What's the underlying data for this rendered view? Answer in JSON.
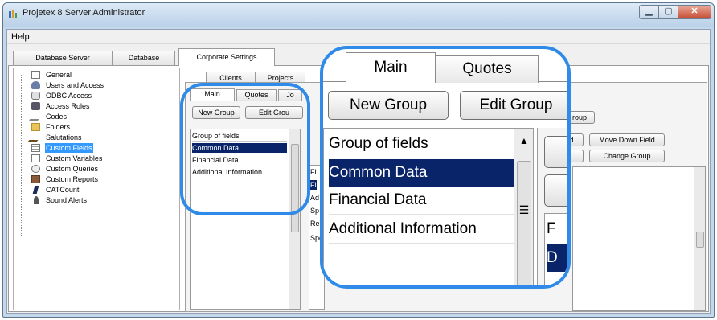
{
  "window": {
    "title": "Projetex 8 Server Administrator",
    "minimize_glyph": "▁",
    "maximize_glyph": "▢",
    "close_glyph": "✕"
  },
  "menu": {
    "help": "Help"
  },
  "top_tabs": [
    "Database Server",
    "Database",
    "Corporate Settings"
  ],
  "tree": {
    "items": [
      {
        "label": "General",
        "icon": "document-icon"
      },
      {
        "label": "Users and Access",
        "icon": "user-icon"
      },
      {
        "label": "ODBC Access",
        "icon": "database-icon"
      },
      {
        "label": "Access Roles",
        "icon": "roles-icon"
      },
      {
        "label": "Codes",
        "icon": "pencil-icon"
      },
      {
        "label": "Folders",
        "icon": "folder-icon"
      },
      {
        "label": "Salutations",
        "icon": "pen-icon"
      },
      {
        "label": "Custom Fields",
        "icon": "fields-icon",
        "selected": true
      },
      {
        "label": "Custom Variables",
        "icon": "document-icon"
      },
      {
        "label": "Custom Queries",
        "icon": "queries-icon"
      },
      {
        "label": "Custom Reports",
        "icon": "reports-icon"
      },
      {
        "label": "CATCount",
        "icon": "catcount-icon"
      },
      {
        "label": "Sound Alerts",
        "icon": "sound-icon"
      }
    ]
  },
  "second_tabs": [
    "Clients",
    "Projects"
  ],
  "third_tabs": [
    "Main",
    "Quotes",
    "Jo"
  ],
  "buttons": {
    "new_group": "New Group",
    "edit_group": "Edit Grou",
    "edit_group_bg": "roup"
  },
  "groups_list": {
    "header": "Group of fields",
    "items": [
      "Common Data",
      "Financial Data",
      "Additional Information"
    ],
    "selected": "Common Data"
  },
  "fields_list_fragments": [
    "Fi",
    "Fi",
    "Ad",
    "Sp",
    "Re",
    "Spe"
  ],
  "right_buttons": {
    "frag_d": "d",
    "move_down_field": "Move Down Field",
    "change_group": "Change Group"
  },
  "zoom": {
    "tabs": [
      "Main",
      "Quotes"
    ],
    "new_group": "New Group",
    "edit_group": "Edit Group",
    "header": "Group of fields",
    "items": [
      "Common Data",
      "Financial Data",
      "Additional Information"
    ],
    "fragment_f": "F",
    "fragment_d": "D",
    "scroll_up": "▲",
    "scroll_grip": "☰"
  },
  "colors": {
    "accent_callout": "#2f8ae8",
    "selection": "#0a246a",
    "tree_selection": "#3399ff"
  }
}
